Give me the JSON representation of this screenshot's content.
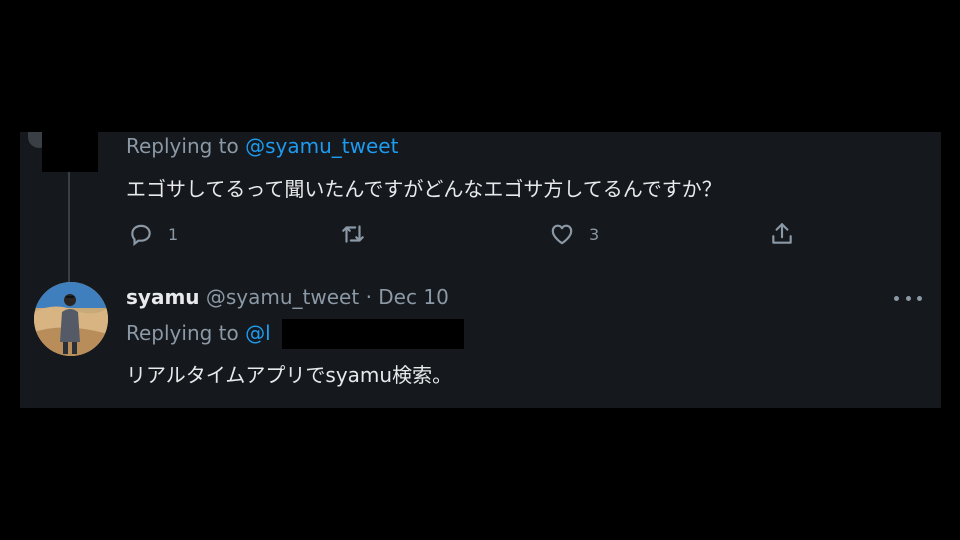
{
  "parent_tweet": {
    "reply_prefix": "Replying to ",
    "reply_handle": "@syamu_tweet",
    "text": "エゴサしてるって聞いたんですがどんなエゴサ方してるんですか？",
    "actions": {
      "reply_count": "1",
      "retweet_count": "",
      "like_count": "3"
    }
  },
  "reply_tweet": {
    "name": "syamu",
    "handle": "@syamu_tweet",
    "separator": "·",
    "date": "Dec 10",
    "reply_prefix": "Replying to ",
    "reply_handle": "@l",
    "text": "リアルタイムアプリでsyamu検索。"
  },
  "colors": {
    "background": "#15181c",
    "text_primary": "#e7e9ea",
    "text_secondary": "#8b98a5",
    "link": "#1d9bf0"
  },
  "icons": [
    "reply-icon",
    "retweet-icon",
    "like-icon",
    "share-icon",
    "more-icon"
  ]
}
